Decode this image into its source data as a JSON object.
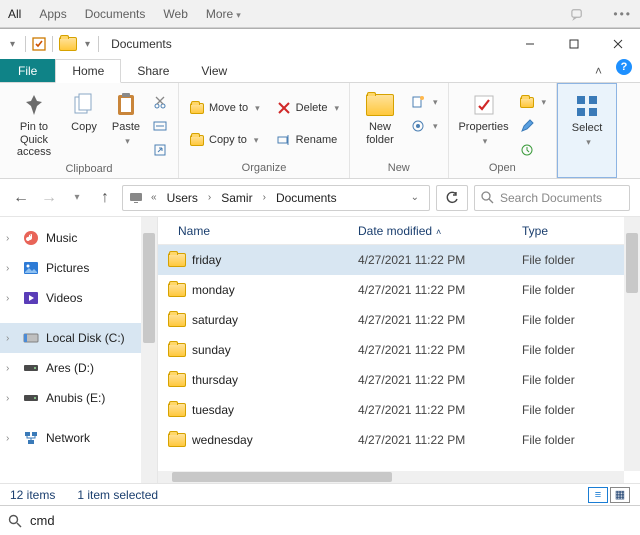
{
  "top_tabs": {
    "all": "All",
    "apps": "Apps",
    "documents": "Documents",
    "web": "Web",
    "more": "More"
  },
  "window": {
    "title": "Documents"
  },
  "ribbon_tabs": {
    "file": "File",
    "home": "Home",
    "share": "Share",
    "view": "View"
  },
  "ribbon": {
    "pin": "Pin to Quick access",
    "copy": "Copy",
    "paste": "Paste",
    "clipboard": "Clipboard",
    "move_to": "Move to",
    "copy_to": "Copy to",
    "delete": "Delete",
    "rename": "Rename",
    "organize": "Organize",
    "new_folder": "New folder",
    "new": "New",
    "properties": "Properties",
    "open": "Open",
    "select": "Select"
  },
  "breadcrumbs": [
    "Users",
    "Samir",
    "Documents"
  ],
  "search_placeholder": "Search Documents",
  "columns": {
    "name": "Name",
    "date": "Date modified",
    "type": "Type"
  },
  "sidebar": {
    "items": [
      {
        "label": "Music",
        "icon": "music"
      },
      {
        "label": "Pictures",
        "icon": "pictures"
      },
      {
        "label": "Videos",
        "icon": "videos"
      },
      {
        "label": "Local Disk (C:)",
        "icon": "disk"
      },
      {
        "label": "Ares (D:)",
        "icon": "drive"
      },
      {
        "label": "Anubis (E:)",
        "icon": "drive"
      },
      {
        "label": "Network",
        "icon": "network"
      }
    ]
  },
  "files": [
    {
      "name": "friday",
      "date": "4/27/2021 11:22 PM",
      "type": "File folder",
      "selected": true
    },
    {
      "name": "monday",
      "date": "4/27/2021 11:22 PM",
      "type": "File folder",
      "selected": false
    },
    {
      "name": "saturday",
      "date": "4/27/2021 11:22 PM",
      "type": "File folder",
      "selected": false
    },
    {
      "name": "sunday",
      "date": "4/27/2021 11:22 PM",
      "type": "File folder",
      "selected": false
    },
    {
      "name": "thursday",
      "date": "4/27/2021 11:22 PM",
      "type": "File folder",
      "selected": false
    },
    {
      "name": "tuesday",
      "date": "4/27/2021 11:22 PM",
      "type": "File folder",
      "selected": false
    },
    {
      "name": "wednesday",
      "date": "4/27/2021 11:22 PM",
      "type": "File folder",
      "selected": false
    }
  ],
  "status": {
    "count": "12 items",
    "selection": "1 item selected"
  },
  "run": {
    "value": "cmd"
  }
}
